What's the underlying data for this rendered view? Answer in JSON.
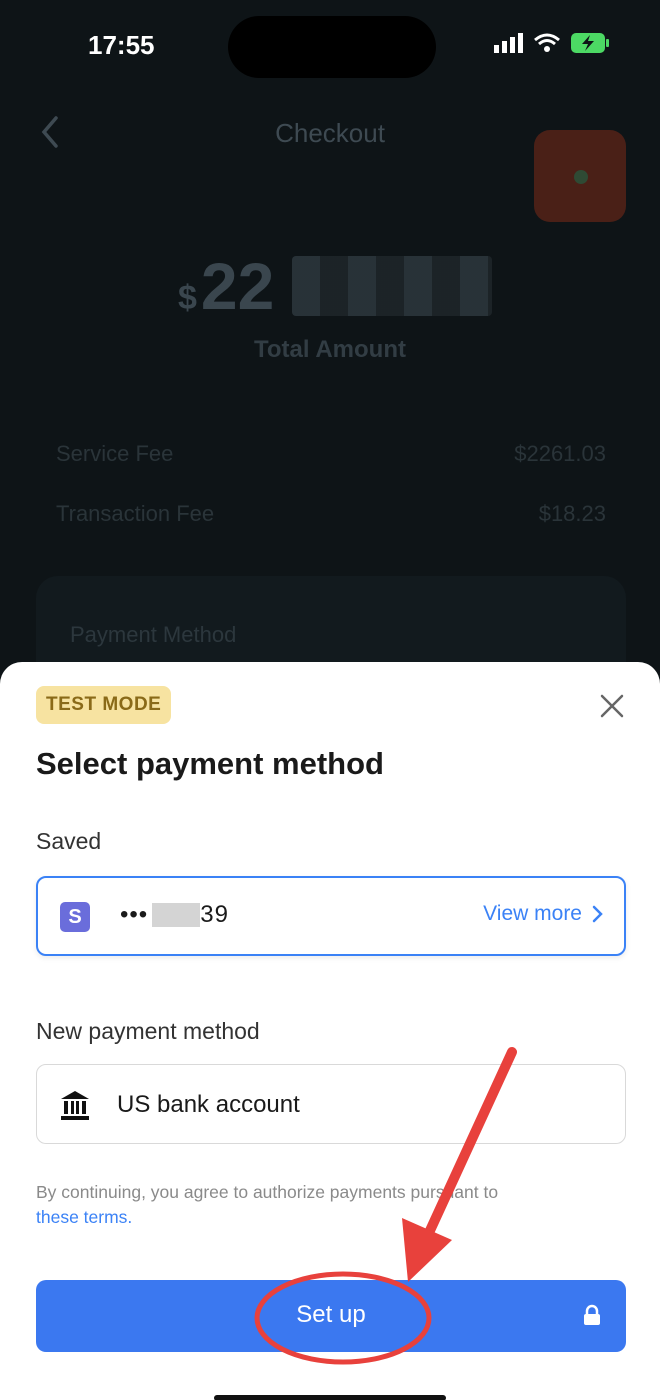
{
  "status_bar": {
    "time": "17:55"
  },
  "checkout": {
    "title": "Checkout",
    "amount_currency": "$",
    "amount_visible": "22",
    "total_label": "Total Amount",
    "fees": [
      {
        "label": "Service Fee",
        "value": "$2261.03"
      },
      {
        "label": "Transaction Fee",
        "value": "$18.23"
      }
    ],
    "payment_method_label": "Payment Method"
  },
  "sheet": {
    "badge": "TEST MODE",
    "title": "Select payment method",
    "saved_label": "Saved",
    "saved_card": {
      "logo_letter": "S",
      "masked_prefix": "•••",
      "masked_suffix": "39",
      "view_more": "View more"
    },
    "new_label": "New payment method",
    "bank_option": "US bank account",
    "terms_text": "By continuing, you agree to authorize payments pursuant to",
    "terms_link": "these terms.",
    "setup_button": "Set up"
  },
  "colors": {
    "accent": "#3b78f0",
    "annotation_red": "#e8413c",
    "badge_bg": "#f7e3a1"
  }
}
